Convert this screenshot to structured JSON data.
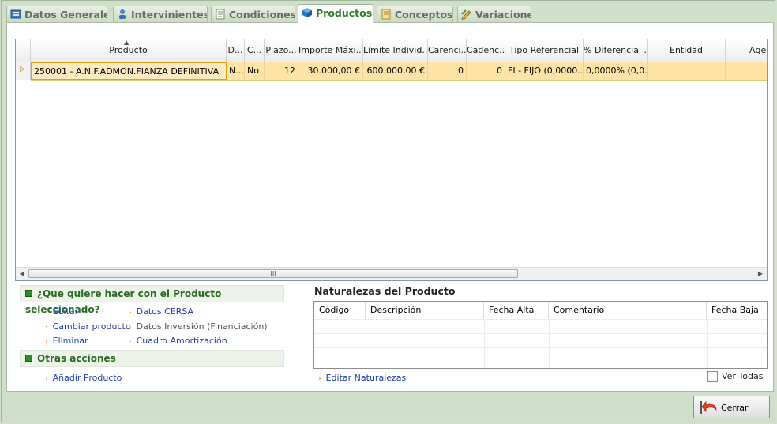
{
  "tabs": [
    {
      "label": "Datos Generales",
      "icon": "datos-generales-icon"
    },
    {
      "label": "Intervinientes",
      "icon": "intervinientes-icon"
    },
    {
      "label": "Condiciones",
      "icon": "condiciones-icon"
    },
    {
      "label": "Productos",
      "icon": "productos-icon",
      "active": true
    },
    {
      "label": "Conceptos",
      "icon": "conceptos-icon"
    },
    {
      "label": "Variaciones",
      "icon": "variaciones-icon"
    }
  ],
  "grid": {
    "columns": [
      "Producto",
      "D...",
      "C...",
      "Plazo...",
      "Importe Máxi...",
      "Límite Individ...",
      "Carenci...",
      "Cadenc...",
      "Tipo Referencial",
      "% Diferencial ...",
      "Entidad",
      "Age"
    ],
    "rows": [
      [
        "250001 - A.N.F.ADMON.FIANZA DEFINITIVA",
        "N...",
        "No",
        "12",
        "30.000,00 €",
        "600.000,00 €",
        "0",
        "0",
        "FI - FIJO (0,0000...",
        "0,0000% (0,0...",
        "",
        ""
      ]
    ],
    "scroll_thumb": "III"
  },
  "actions": {
    "title": "¿Que quiere hacer con el Producto seleccionado?",
    "links_left": [
      "Editar",
      "Cambiar producto",
      "Eliminar"
    ],
    "links_right": [
      "Datos CERSA",
      "Datos Inversión (Financiación)",
      "Cuadro Amortización"
    ],
    "other_title": "Otras acciones",
    "other_links": [
      "Añadir Producto"
    ]
  },
  "naturalezas": {
    "title": "Naturalezas del Producto",
    "columns": [
      "Código",
      "Descripción",
      "Fecha Alta",
      "Comentario",
      "Fecha Baja"
    ],
    "edit_link": "Editar Naturalezas",
    "ver_todas": "Ver Todas",
    "ver_todas_checked": false
  },
  "close_button": "Cerrar"
}
